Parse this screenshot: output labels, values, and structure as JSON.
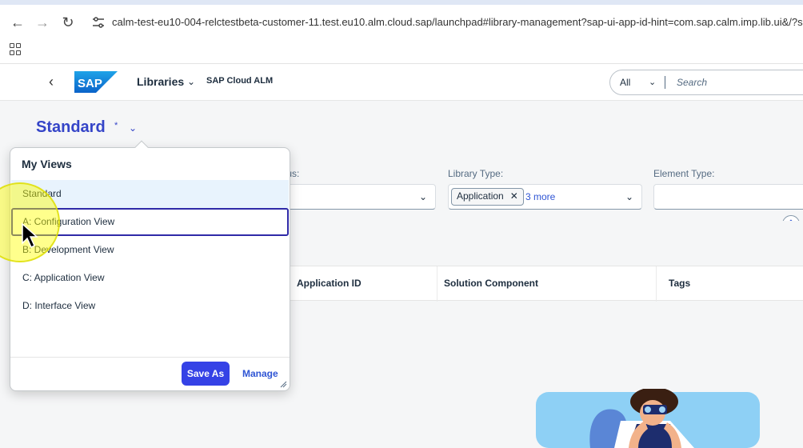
{
  "browser": {
    "url": "calm-test-eu10-004-relctestbeta-customer-11.test.eu10.alm.cloud.sap/launchpad#library-management?sap-ui-app-id-hint=com.sap.calm.imp.lib.ui&/?sap-iapp-"
  },
  "shell": {
    "logo_text": "SAP",
    "app_title": "Libraries",
    "product": "SAP Cloud ALM",
    "search_scope": "All",
    "search_placeholder": "Search"
  },
  "variant": {
    "title": "Standard",
    "modified_marker": "*"
  },
  "filters": [
    {
      "label": "tus:",
      "value": ""
    },
    {
      "label": "Library Type:",
      "token": "Application",
      "more": "3 more"
    },
    {
      "label": "Element Type:",
      "value": ""
    }
  ],
  "table": {
    "columns": [
      "Application ID",
      "Solution Component",
      "Tags"
    ]
  },
  "popover": {
    "title": "My Views",
    "items": [
      {
        "label": "Standard",
        "selected": true
      },
      {
        "label": "A: Configuration View",
        "focused": true
      },
      {
        "label": "B: Development View"
      },
      {
        "label": "C: Application View"
      },
      {
        "label": "D: Interface View"
      }
    ],
    "save_as": "Save As",
    "manage": "Manage"
  },
  "colors": {
    "accent": "#3545c8",
    "button": "#3542e6",
    "link": "#2f55d4",
    "highlight": "#ffff00"
  }
}
